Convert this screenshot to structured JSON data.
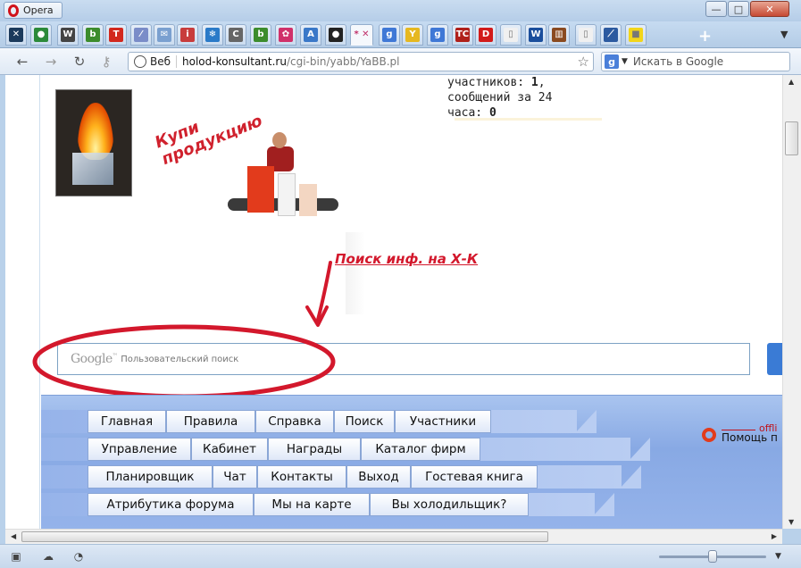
{
  "window": {
    "app_name": "Opera",
    "min_glyph": "—",
    "max_glyph": "□",
    "close_glyph": "✕"
  },
  "tabs": [
    {
      "icon": "x-shape-icon",
      "glyph": "✕",
      "color": "#1b3a5c"
    },
    {
      "icon": "green-logo-icon",
      "glyph": "●",
      "color": "#2c8a3a"
    },
    {
      "icon": "wikipedia-icon",
      "glyph": "W",
      "color": "#444444"
    },
    {
      "icon": "green-book-icon",
      "glyph": "b",
      "color": "#3c8c2c"
    },
    {
      "icon": "red-square-icon",
      "glyph": "T",
      "color": "#d2281e"
    },
    {
      "icon": "feather-icon",
      "glyph": "⁄",
      "color": "#7a8cc8"
    },
    {
      "icon": "mail-icon",
      "glyph": "✉",
      "color": "#7aa0d0"
    },
    {
      "icon": "inf-icon",
      "glyph": "i",
      "color": "#c83c3c"
    },
    {
      "icon": "snowflake-icon",
      "glyph": "❄",
      "color": "#2a7ac8"
    },
    {
      "icon": "c-logo-icon",
      "glyph": "C",
      "color": "#666666"
    },
    {
      "icon": "green-book-icon",
      "glyph": "b",
      "color": "#3c8c2c"
    },
    {
      "icon": "pink-gear-icon",
      "glyph": "✿",
      "color": "#d0306a"
    },
    {
      "icon": "translate-icon",
      "glyph": "A",
      "color": "#3a78c8"
    },
    {
      "icon": "soccer-ball-icon",
      "glyph": "●",
      "color": "#222222"
    },
    {
      "icon": "current-tab-icon",
      "glyph": "* ✕",
      "color": "#f5f8fc",
      "active": true
    },
    {
      "icon": "google-icon",
      "glyph": "g",
      "color": "#3f78d6"
    },
    {
      "icon": "yandex-icon",
      "glyph": "Y",
      "color": "#e6b820"
    },
    {
      "icon": "google-icon",
      "glyph": "g",
      "color": "#3f78d6"
    },
    {
      "icon": "tch-icon",
      "glyph": "TC",
      "color": "#b0201a"
    },
    {
      "icon": "d-logo-icon",
      "glyph": "D",
      "color": "#d21a1a"
    },
    {
      "icon": "blank-page-icon",
      "glyph": "▯",
      "color": "#f0f0f0"
    },
    {
      "icon": "vw-logo-icon",
      "glyph": "W",
      "color": "#1a4e9c"
    },
    {
      "icon": "books-icon",
      "glyph": "▥",
      "color": "#8a4a20"
    },
    {
      "icon": "blank-page-icon",
      "glyph": "▯",
      "color": "#f0f0f0"
    },
    {
      "icon": "chart-line-icon",
      "glyph": "⟋",
      "color": "#2c5aa0"
    },
    {
      "icon": "yellow-square-icon",
      "glyph": "■",
      "color": "#f2d51a"
    }
  ],
  "tabbar": {
    "add_glyph": "+",
    "menu_glyph": "▼"
  },
  "nav": {
    "back": "←",
    "forward": "→",
    "reload": "↻",
    "key": "⚷",
    "address_label": "Веб",
    "url_host": "holod-konsultant.ru",
    "url_path": "/cgi-bin/yabb/YaBB.pl",
    "star": "☆",
    "search_placeholder": "Искать в Google",
    "search_engine_letter": "g",
    "search_arrow": "▼"
  },
  "stats": {
    "participants_label": "участников:",
    "participants_value": "1",
    "messages_label": "сообщений за 24",
    "hours_label": "часа:",
    "messages_value": "0"
  },
  "promo": {
    "line1": "Купи",
    "line2": "продукцию"
  },
  "xk_link": "Поиск инф. на Х-К",
  "google_search": {
    "logo": "Google",
    "tm": "™",
    "placeholder": "Пользовательский поиск"
  },
  "menu": {
    "row1": [
      "Главная",
      "Правила",
      "Справка",
      "Поиск",
      "Участники"
    ],
    "row2": [
      "Управление",
      "Кабинет",
      "Награды",
      "Каталог фирм"
    ],
    "row3": [
      "Планировщик",
      "Чат",
      "Контакты",
      "Выход",
      "Гостевая книга"
    ],
    "row4": [
      "Атрибутика форума",
      "Мы на карте",
      "Вы холодильщик?"
    ]
  },
  "help": {
    "offline": "offli",
    "label": "Помощь п"
  },
  "scroll": {
    "up": "▲",
    "down": "▼",
    "left": "◀",
    "right": "▶"
  },
  "statusbar": {
    "panel_glyph": "▣",
    "cloud_glyph": "☁",
    "speed_glyph": "◔",
    "zoom_menu": "▼",
    "zoom_fraction": 0.5
  }
}
